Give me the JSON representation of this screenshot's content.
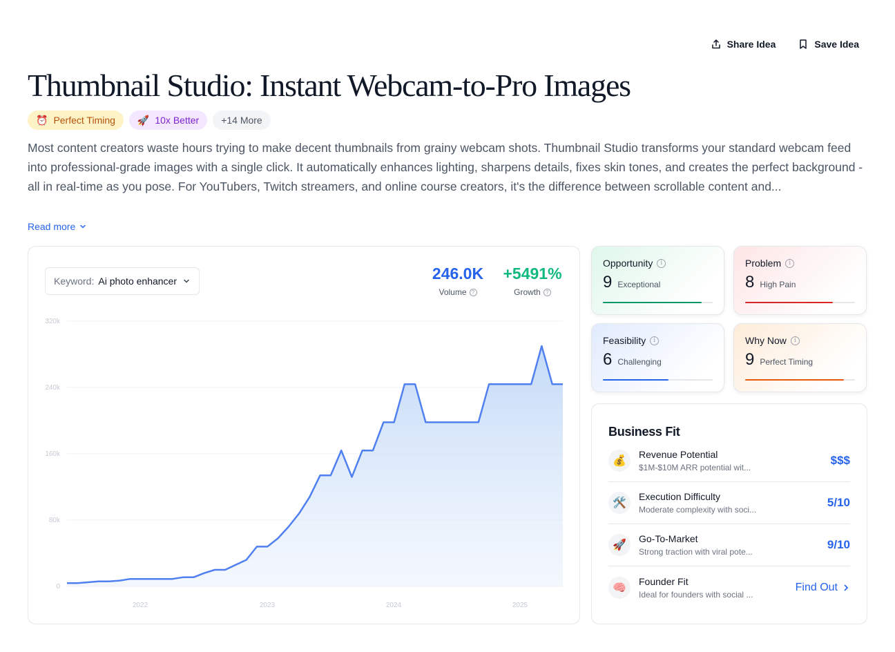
{
  "actions": {
    "share_label": "Share Idea",
    "save_label": "Save Idea"
  },
  "title": "Thumbnail Studio: Instant Webcam-to-Pro Images",
  "tags": [
    {
      "emoji": "⏰",
      "label": "Perfect Timing"
    },
    {
      "emoji": "🚀",
      "label": "10x Better"
    },
    {
      "label": "+14 More"
    }
  ],
  "description": "Most content creators waste hours trying to make decent thumbnails from grainy webcam shots. Thumbnail Studio transforms your standard webcam feed into professional-grade images with a single click. It automatically enhances lighting, sharpens details, fixes skin tones, and creates the perfect background - all in real-time as you pose. For YouTubers, Twitch streamers, and online course creators, it's the difference between scrollable content and...",
  "read_more": "Read more",
  "keyword": {
    "label": "Keyword:",
    "value": "Ai photo enhancer"
  },
  "stats": {
    "volume": {
      "value": "246.0K",
      "label": "Volume",
      "color": "#2563eb"
    },
    "growth": {
      "value": "+5491%",
      "label": "Growth",
      "color": "#10b981"
    }
  },
  "chart_data": {
    "type": "area",
    "ylabel_ticks": [
      "0",
      "80k",
      "160k",
      "240k",
      "320k"
    ],
    "xlabel_ticks": [
      "2022",
      "2023",
      "2024",
      "2025"
    ],
    "ylim": [
      0,
      320000
    ],
    "grid": true,
    "color": "#4f7ff0",
    "x": [
      "2021-03",
      "2021-04",
      "2021-05",
      "2021-06",
      "2021-07",
      "2021-08",
      "2021-09",
      "2021-10",
      "2021-11",
      "2021-12",
      "2022-01",
      "2022-02",
      "2022-03",
      "2022-04",
      "2022-05",
      "2022-06",
      "2022-07",
      "2022-08",
      "2022-09",
      "2022-10",
      "2022-11",
      "2022-12",
      "2023-01",
      "2023-02",
      "2023-03",
      "2023-04",
      "2023-05",
      "2023-06",
      "2023-07",
      "2023-08",
      "2023-09",
      "2023-10",
      "2023-11",
      "2023-12",
      "2024-01",
      "2024-02",
      "2024-03",
      "2024-04",
      "2024-05",
      "2024-06",
      "2024-07",
      "2024-08",
      "2024-09",
      "2024-10",
      "2024-11",
      "2024-12",
      "2025-01",
      "2025-02",
      "2025-03",
      "2025-04"
    ],
    "values": [
      4000,
      4000,
      5000,
      6000,
      6000,
      7000,
      9000,
      9000,
      9000,
      9000,
      9000,
      11000,
      11000,
      16000,
      20000,
      20000,
      26000,
      32000,
      48000,
      48000,
      58000,
      72000,
      88000,
      108000,
      134000,
      134000,
      164000,
      132000,
      164000,
      164000,
      198000,
      198000,
      244000,
      244000,
      198000,
      198000,
      198000,
      198000,
      198000,
      198000,
      244000,
      244000,
      244000,
      244000,
      244000,
      290000,
      244000,
      244000
    ]
  },
  "scores": [
    {
      "title": "Opportunity",
      "value": "9",
      "word": "Exceptional",
      "fill": 0.9,
      "color": "#059669",
      "bg": "linear-gradient(135deg,#dff7ea 0%,#ffffff 80%)"
    },
    {
      "title": "Problem",
      "value": "8",
      "word": "High Pain",
      "fill": 0.8,
      "color": "#dc2626",
      "bg": "linear-gradient(135deg,#fde5e5 0%,#ffffff 80%)"
    },
    {
      "title": "Feasibility",
      "value": "6",
      "word": "Challenging",
      "fill": 0.6,
      "color": "#2563eb",
      "bg": "linear-gradient(135deg,#e1ebfd 0%,#ffffff 80%)"
    },
    {
      "title": "Why Now",
      "value": "9",
      "word": "Perfect Timing",
      "fill": 0.9,
      "color": "#ea580c",
      "bg": "linear-gradient(135deg,#fdecd9 0%,#ffffff 80%)"
    }
  ],
  "business_fit": {
    "title": "Business Fit",
    "rows": [
      {
        "emoji": "💰",
        "name": "Revenue Potential",
        "sub": "$1M-$10M ARR potential wit...",
        "value": "$$$"
      },
      {
        "emoji": "🛠️",
        "name": "Execution Difficulty",
        "sub": "Moderate complexity with soci...",
        "value": "5/10"
      },
      {
        "emoji": "🚀",
        "name": "Go-To-Market",
        "sub": "Strong traction with viral pote...",
        "value": "9/10"
      },
      {
        "emoji": "🧠",
        "name": "Founder Fit",
        "sub": "Ideal for founders with social ...",
        "value": "Find Out"
      }
    ]
  }
}
